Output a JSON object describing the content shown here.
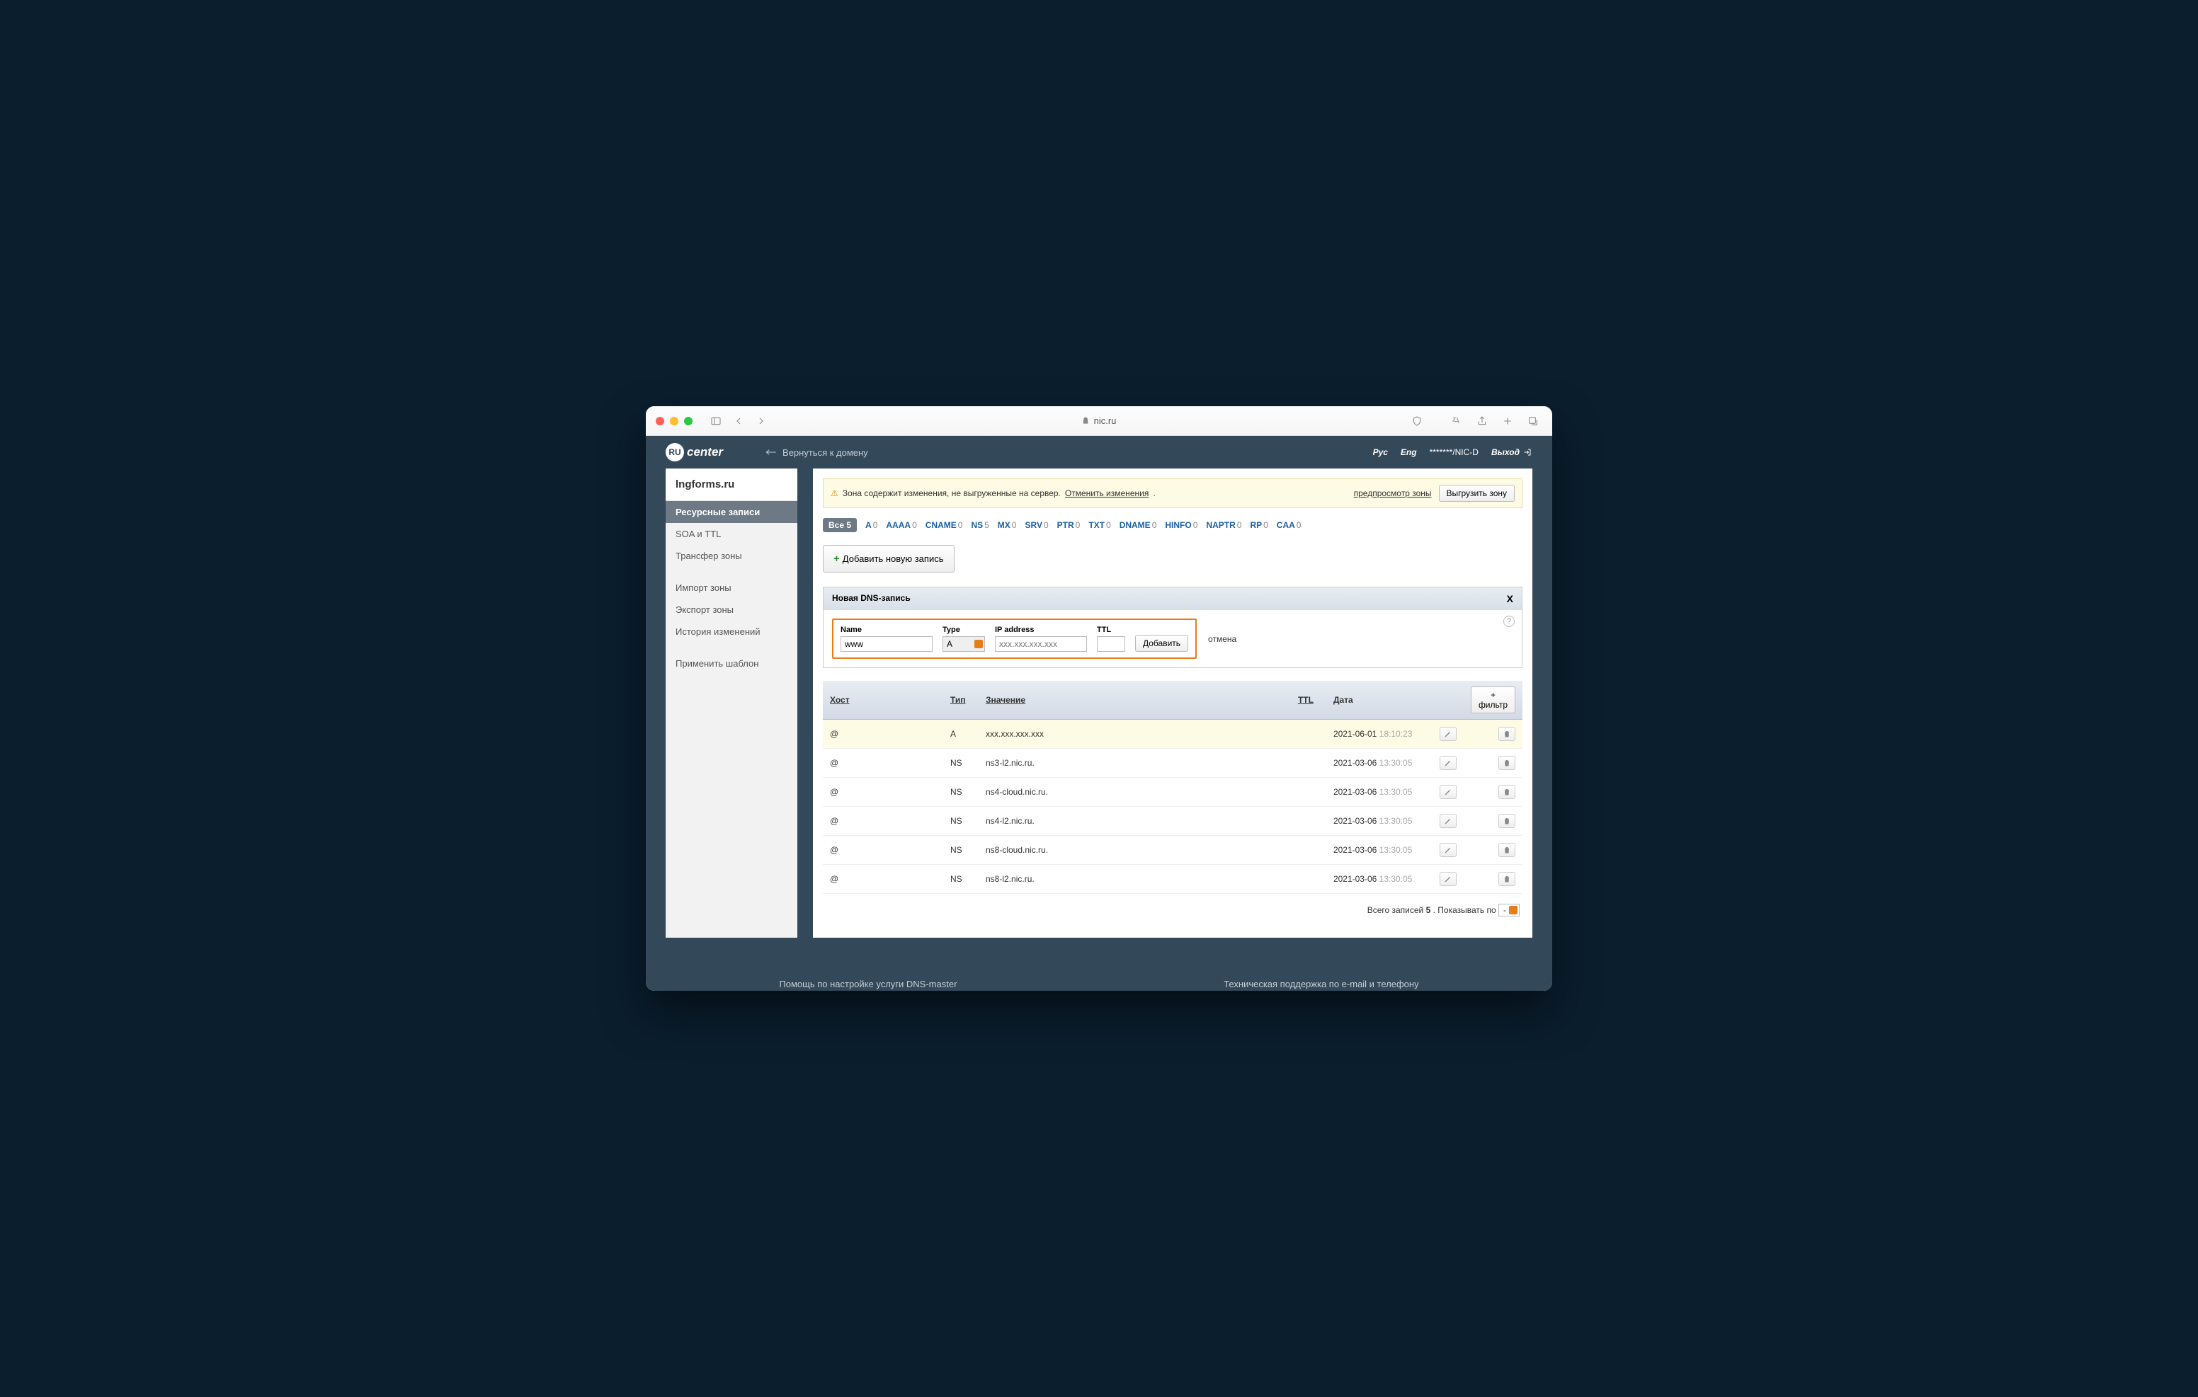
{
  "browser": {
    "url": "nic.ru"
  },
  "header": {
    "logo_prefix": "RU",
    "logo_text": "center",
    "back": "Вернуться к домену",
    "lang_ru": "Рус",
    "lang_en": "Eng",
    "account": "*******/NIC-D",
    "logout": "Выход"
  },
  "sidebar": {
    "domain": "lngforms.ru",
    "items": [
      "Ресурсные записи",
      "SOA и TTL",
      "Трансфер зоны"
    ],
    "items2": [
      "Импорт зоны",
      "Экспорт зоны",
      "История изменений"
    ],
    "items3": [
      "Применить шаблон"
    ]
  },
  "alert": {
    "text": "Зона содержит изменения, не выгруженные на сервер. ",
    "undo": "Отменить изменения",
    "preview": "предпросмотр зоны",
    "publish": "Выгрузить зону"
  },
  "filters": {
    "all_label": "Все",
    "all_count": "5",
    "items": [
      {
        "l": "A",
        "c": "0"
      },
      {
        "l": "AAAA",
        "c": "0"
      },
      {
        "l": "CNAME",
        "c": "0"
      },
      {
        "l": "NS",
        "c": "5"
      },
      {
        "l": "MX",
        "c": "0"
      },
      {
        "l": "SRV",
        "c": "0"
      },
      {
        "l": "PTR",
        "c": "0"
      },
      {
        "l": "TXT",
        "c": "0"
      },
      {
        "l": "DNAME",
        "c": "0"
      },
      {
        "l": "HINFO",
        "c": "0"
      },
      {
        "l": "NAPTR",
        "c": "0"
      },
      {
        "l": "RP",
        "c": "0"
      },
      {
        "l": "CAA",
        "c": "0"
      }
    ]
  },
  "add_record": "Добавить новую запись",
  "new_record": {
    "title": "Новая DNS-запись",
    "close": "X",
    "name_l": "Name",
    "type_l": "Type",
    "ip_l": "IP address",
    "ttl_l": "TTL",
    "name_v": "www",
    "type_v": "A",
    "ip_ph": "xxx.xxx.xxx.xxx",
    "submit": "Добавить",
    "cancel": "отмена"
  },
  "table": {
    "h_host": "Хост",
    "h_type": "Тип",
    "h_value": "Значение",
    "h_ttl": "TTL",
    "h_date": "Дата",
    "h_filter": "+ фильтр",
    "rows": [
      {
        "host": "@",
        "type": "A",
        "value": "xxx.xxx.xxx.xxx",
        "date": "2021-06-01",
        "time": "18:10:23",
        "hl": true
      },
      {
        "host": "@",
        "type": "NS",
        "value": "ns3-l2.nic.ru.",
        "date": "2021-03-06",
        "time": "13:30:05"
      },
      {
        "host": "@",
        "type": "NS",
        "value": "ns4-cloud.nic.ru.",
        "date": "2021-03-06",
        "time": "13:30:05"
      },
      {
        "host": "@",
        "type": "NS",
        "value": "ns4-l2.nic.ru.",
        "date": "2021-03-06",
        "time": "13:30:05"
      },
      {
        "host": "@",
        "type": "NS",
        "value": "ns8-cloud.nic.ru.",
        "date": "2021-03-06",
        "time": "13:30:05"
      },
      {
        "host": "@",
        "type": "NS",
        "value": "ns8-l2.nic.ru.",
        "date": "2021-03-06",
        "time": "13:30:05"
      }
    ]
  },
  "footer": {
    "total_pre": "Всего записей ",
    "total_n": "5",
    "total_post": " . Показывать по",
    "sel": "-"
  },
  "bottom": {
    "left": "Помощь по настройке услуги DNS-master",
    "right": "Техническая поддержка по e-mail и телефону"
  }
}
